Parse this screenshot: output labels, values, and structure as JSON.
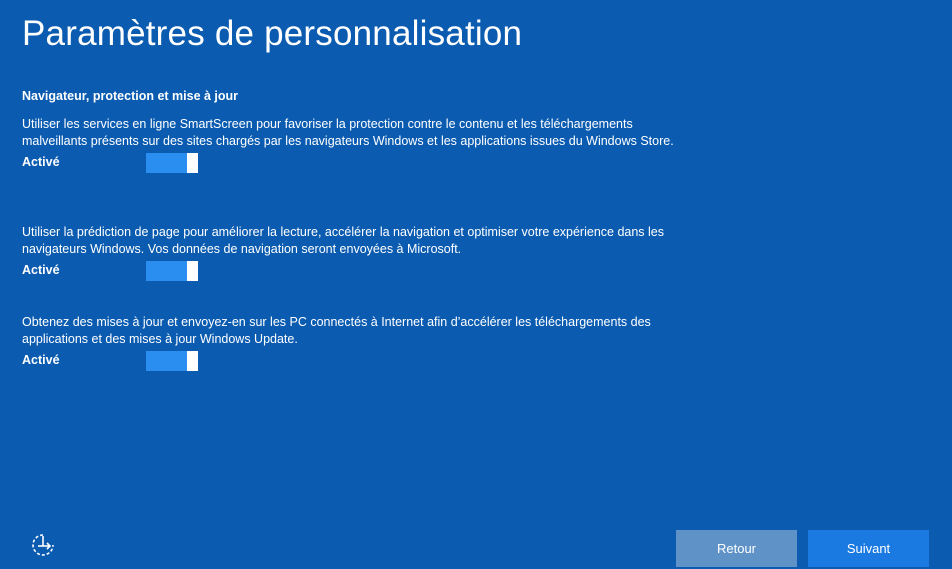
{
  "page": {
    "title": "Paramètres de personnalisation",
    "section_header": "Navigateur, protection et mise à jour"
  },
  "settings": [
    {
      "description": "Utiliser les services en ligne SmartScreen pour favoriser la protection contre le contenu et les téléchargements malveillants présents sur des sites chargés par les navigateurs Windows et les applications issues du Windows Store.",
      "state_label": "Activé",
      "enabled": true
    },
    {
      "description": "Utiliser la prédiction de page pour améliorer la lecture, accélérer la navigation et optimiser votre expérience dans les navigateurs Windows. Vos données de navigation seront envoyées à Microsoft.",
      "state_label": "Activé",
      "enabled": true
    },
    {
      "description": "Obtenez des mises à jour et envoyez-en sur les PC connectés à Internet afin d’accélérer les téléchargements des applications et des mises à jour Windows Update.",
      "state_label": "Activé",
      "enabled": true
    }
  ],
  "footer": {
    "accessibility_icon": "ease-of-access-icon",
    "back_label": "Retour",
    "next_label": "Suivant"
  },
  "colors": {
    "background": "#0b5cb1",
    "toggle_on": "#2a8ef0",
    "back_button": "#5f93c8",
    "next_button": "#1b7ae2"
  }
}
